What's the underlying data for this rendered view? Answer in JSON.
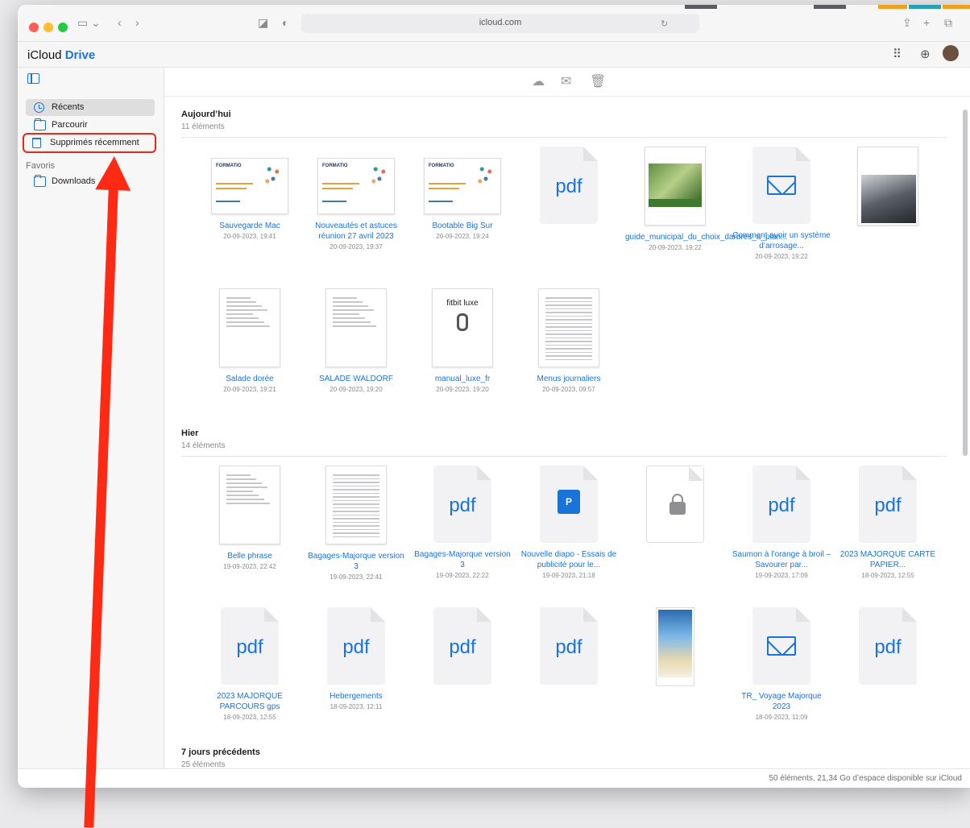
{
  "browser": {
    "url": "icloud.com"
  },
  "app": {
    "brand_prefix": "iCloud",
    "brand_product": "Drive"
  },
  "sidebar": {
    "items": [
      {
        "label": "Récents"
      },
      {
        "label": "Parcourir"
      },
      {
        "label": "Supprimés récemment"
      }
    ],
    "favorites_label": "Favoris",
    "favorites": [
      {
        "label": "Downloads"
      }
    ]
  },
  "sections": [
    {
      "title": "Aujourd’hui",
      "count": "11 éléments",
      "files": [
        {
          "name": "Sauvegarde Mac",
          "date": "20-09-2023, 19:41",
          "kind": "doc-land"
        },
        {
          "name": "Nouveautés et astuces réunion 27 avril 2023",
          "date": "20-09-2023, 19:37",
          "kind": "doc-land"
        },
        {
          "name": "Bootable Big Sur",
          "date": "20-09-2023, 19:24",
          "kind": "doc-land"
        },
        {
          "name": "",
          "date": "",
          "kind": "pdf"
        },
        {
          "name": "guide_municipal_du_choix_darbres_a_plan...",
          "date": "20-09-2023, 19:22",
          "kind": "guide"
        },
        {
          "name": "Comment avoir un système d’arrosage...",
          "date": "20-09-2023, 19:22",
          "kind": "mail"
        },
        {
          "name": "",
          "date": "",
          "kind": "photo"
        },
        {
          "name": "Salade dorée",
          "date": "20-09-2023, 19:21",
          "kind": "doc-port"
        },
        {
          "name": "SALADE WALDORF",
          "date": "20-09-2023, 19:20",
          "kind": "doc-port"
        },
        {
          "name": "manual_luxe_fr",
          "date": "20-09-2023, 19:20",
          "kind": "fitbit"
        },
        {
          "name": "Menus journaliers",
          "date": "20-09-2023, 09:57",
          "kind": "sheet"
        }
      ]
    },
    {
      "title": "Hier",
      "count": "14 éléments",
      "files": [
        {
          "name": "Belle phrase",
          "date": "19-09-2023, 22:42",
          "kind": "doc-port"
        },
        {
          "name": "Bagages-Majorque version 3",
          "date": "19-09-2023, 22:41",
          "kind": "sheet"
        },
        {
          "name": "Bagages-Majorque version 3",
          "date": "19-09-2023, 22:22",
          "kind": "pdf"
        },
        {
          "name": "Nouvelle diapo - Essais de publicité pour le...",
          "date": "19-09-2023, 21:18",
          "kind": "ppt"
        },
        {
          "name": "",
          "date": "",
          "kind": "lock"
        },
        {
          "name": "Saumon à l’orange à broil – Savourer par...",
          "date": "19-09-2023, 17:09",
          "kind": "pdf"
        },
        {
          "name": "2023 MAJORQUE CARTE PAPIER...",
          "date": "18-09-2023, 12:55",
          "kind": "pdf"
        },
        {
          "name": "2023 MAJORQUE PARCOURS gps",
          "date": "18-09-2023, 12:55",
          "kind": "pdf"
        },
        {
          "name": "Hebergements",
          "date": "18-09-2023, 12:11",
          "kind": "pdf"
        },
        {
          "name": "",
          "date": "",
          "kind": "pdf"
        },
        {
          "name": "",
          "date": "",
          "kind": "pdf"
        },
        {
          "name": "",
          "date": "",
          "kind": "brochure"
        },
        {
          "name": "TR_ Voyage Majorque 2023",
          "date": "18-09-2023, 11:09",
          "kind": "mail"
        },
        {
          "name": "",
          "date": "",
          "kind": "pdf"
        }
      ]
    },
    {
      "title": "7 jours précédents",
      "count": "25 éléments",
      "files": []
    }
  ],
  "status_bar": "50 éléments, 21,34 Go d’espace disponible sur iCloud",
  "icons": {
    "pdf_label": "pdf",
    "fitbit_label": "fitbit luxe",
    "ppt_label": "P"
  },
  "colors": {
    "accent": "#1a73d9",
    "annotation": "#e8271a"
  }
}
